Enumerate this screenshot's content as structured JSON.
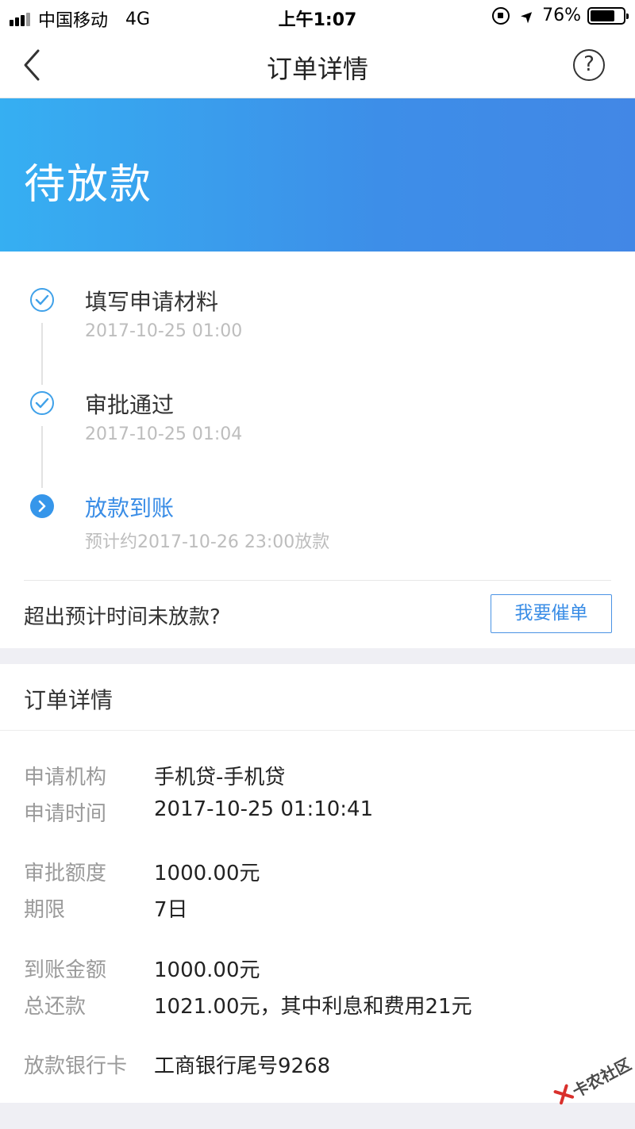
{
  "status_bar": {
    "carrier": "中国移动",
    "network": "4G",
    "time": "上午1:07",
    "battery": "76%",
    "battery_level": 0.76
  },
  "nav": {
    "title": "订单详情",
    "help_symbol": "?"
  },
  "banner": {
    "status": "待放款",
    "gradient": [
      "#36aff2",
      "#4287e6"
    ]
  },
  "timeline": {
    "steps": [
      {
        "title": "填写申请材料",
        "subtitle": "2017-10-25 01:00",
        "state": "done"
      },
      {
        "title": "审批通过",
        "subtitle": "2017-10-25 01:04",
        "state": "done"
      },
      {
        "title": "放款到账",
        "subtitle": "预计约2017-10-26 23:00放款",
        "state": "current"
      }
    ],
    "overdue_prompt": "超出预计时间未放款?",
    "urge_button": "我要催单"
  },
  "details": {
    "header": "订单详情",
    "rows": [
      {
        "label": "申请机构",
        "value": "手机贷-手机贷"
      },
      {
        "label": "申请时间",
        "value": "2017-10-25 01:10:41"
      },
      {
        "label": "审批额度",
        "value": "1000.00元"
      },
      {
        "label": "期限",
        "value": "7日"
      },
      {
        "label": "到账金额",
        "value": "1000.00元"
      },
      {
        "label": "总还款",
        "value": "1021.00元，其中利息和费用21元"
      },
      {
        "label": "放款银行卡",
        "value": "工商银行尾号9268"
      }
    ]
  },
  "watermark": {
    "text": "卡农社区"
  },
  "colors": {
    "accent": "#3a8de6",
    "muted_text": "#9a9a9a",
    "timestamp_text": "#bdbdbd",
    "section_gap": "#efeff4"
  }
}
